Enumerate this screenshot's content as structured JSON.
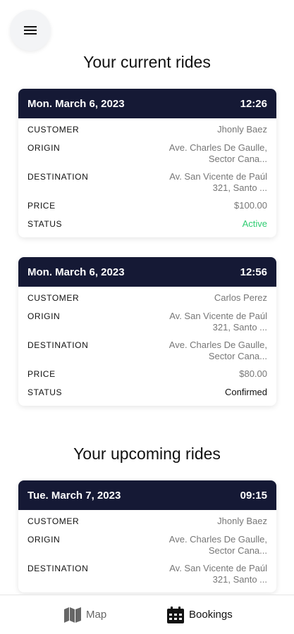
{
  "current_title": "Your current rides",
  "upcoming_title": "Your upcoming rides",
  "labels": {
    "customer": "CUSTOMER",
    "origin": "ORIGIN",
    "destination": "DESTINATION",
    "price": "PRICE",
    "status": "STATUS"
  },
  "current_rides": [
    {
      "date": "Mon. March 6, 2023",
      "time": "12:26",
      "customer": "Jhonly Baez",
      "origin": "Ave. Charles De Gaulle,\nSector Cana...",
      "destination": "Av. San Vicente de Paúl\n321, Santo ...",
      "price": "$100.00",
      "status": "Active"
    },
    {
      "date": "Mon. March 6, 2023",
      "time": "12:56",
      "customer": "Carlos Perez",
      "origin": "Av. San Vicente de Paúl\n321, Santo ...",
      "destination": "Ave. Charles De Gaulle,\nSector Cana...",
      "price": "$80.00",
      "status": "Confirmed"
    }
  ],
  "upcoming_rides": [
    {
      "date": "Tue. March 7, 2023",
      "time": "09:15",
      "customer": "Jhonly Baez",
      "origin": "Ave. Charles De Gaulle,\nSector Cana...",
      "destination": "Av. San Vicente de Paúl\n321, Santo ..."
    }
  ],
  "nav": {
    "map": "Map",
    "bookings": "Bookings"
  },
  "colors": {
    "header_bg": "#151935",
    "active_status": "#2ecc71"
  },
  "icons": {
    "menu": "hamburger-menu-icon",
    "map": "map-icon",
    "bookings": "calendar-icon"
  }
}
